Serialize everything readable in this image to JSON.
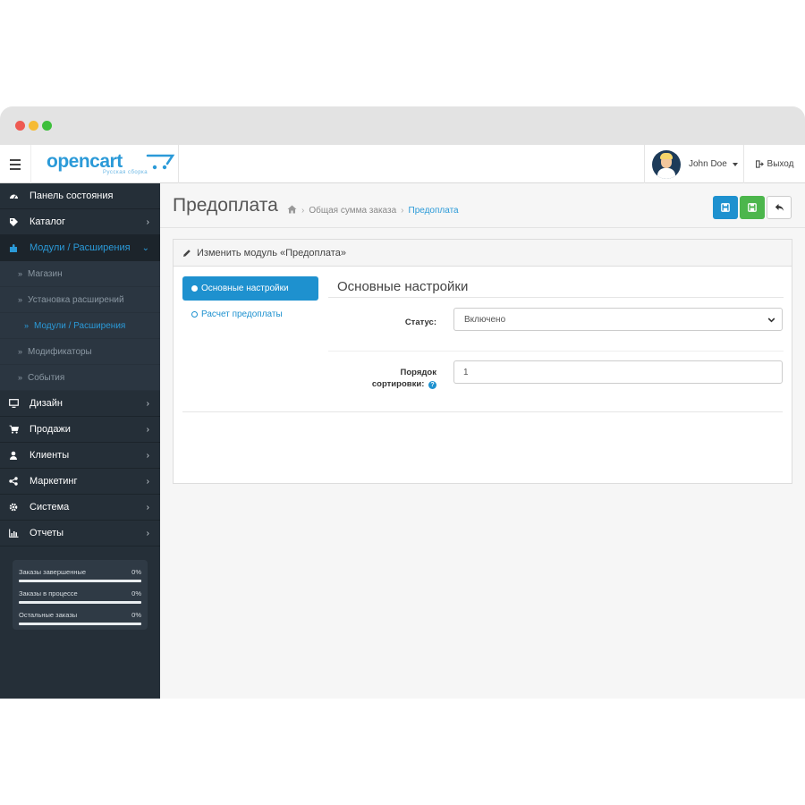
{
  "app": {
    "logo": "opencart",
    "logo_subtitle": "Русская сборка",
    "user": "John Doe",
    "logout": "Выход"
  },
  "sidebar": {
    "items": [
      {
        "label": "Панель состояния",
        "icon": "dashboard-icon"
      },
      {
        "label": "Каталог",
        "icon": "tag-icon",
        "chevron": true
      },
      {
        "label": "Модули / Расширения",
        "icon": "puzzle-icon",
        "chevron": true,
        "active": true
      },
      {
        "label": "Дизайн",
        "icon": "monitor-icon",
        "chevron": true
      },
      {
        "label": "Продажи",
        "icon": "cart-icon",
        "chevron": true
      },
      {
        "label": "Клиенты",
        "icon": "user-icon",
        "chevron": true
      },
      {
        "label": "Маркетинг",
        "icon": "share-icon",
        "chevron": true
      },
      {
        "label": "Система",
        "icon": "gear-icon",
        "chevron": true
      },
      {
        "label": "Отчеты",
        "icon": "bar-chart-icon",
        "chevron": true
      }
    ],
    "subitems": [
      {
        "label": "Магазин"
      },
      {
        "label": "Установка расширений"
      },
      {
        "label": "Модули / Расширения",
        "active": true
      },
      {
        "label": "Модификаторы"
      },
      {
        "label": "События"
      }
    ],
    "stats": [
      {
        "label": "Заказы завершенные",
        "value": "0%",
        "fraction": 0
      },
      {
        "label": "Заказы в процессе",
        "value": "0%",
        "fraction": 0
      },
      {
        "label": "Остальные заказы",
        "value": "0%",
        "fraction": 0
      }
    ]
  },
  "page": {
    "title": "Предоплата",
    "breadcrumbs": [
      "Общая сумма заказа",
      "Предоплата"
    ]
  },
  "panel": {
    "heading": "Изменить модуль «Предоплата»",
    "tabs": [
      "Основные настройки",
      "Расчет предоплаты"
    ],
    "legend": "Основные настройки",
    "status_label": "Статус:",
    "status_value": "Включено",
    "sort_label_1": "Порядок",
    "sort_label_2": "сортировки:",
    "sort_value": "1"
  },
  "colors": {
    "sidebar_bg": "#252f38",
    "accent": "#1e91cf",
    "success": "#4cb64c"
  }
}
